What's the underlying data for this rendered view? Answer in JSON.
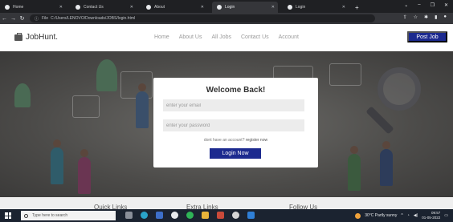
{
  "browser": {
    "tabs": [
      {
        "title": "Home",
        "active": false
      },
      {
        "title": "Contact Us",
        "active": false
      },
      {
        "title": "About",
        "active": false
      },
      {
        "title": "Login",
        "active": true
      },
      {
        "title": "Login",
        "active": false
      }
    ],
    "new_tab": "+",
    "url_info": "File",
    "url": "C:/Users/LENOVO/Downloads/JOBS/login.html"
  },
  "site": {
    "logo": "JobHunt.",
    "nav": [
      "Home",
      "About Us",
      "All Jobs",
      "Contact Us",
      "Account"
    ],
    "post_job": "Post Job"
  },
  "login": {
    "title": "Welcome Back!",
    "email_placeholder": "enter your email",
    "password_placeholder": "enter your password",
    "no_account_text": "dont have an account?",
    "register_link": "register now",
    "login_button": "Login Now"
  },
  "footer": {
    "headings": [
      "Quick Links",
      "Extra Links",
      "Follow Us"
    ]
  },
  "taskbar": {
    "search_placeholder": "Type here to search",
    "weather": "30°C Partly sunny",
    "time": "09:57",
    "date": "01-05-2022"
  },
  "colors": {
    "brand": "#1c2a8f",
    "hero_overlay": "#4c4b49"
  }
}
